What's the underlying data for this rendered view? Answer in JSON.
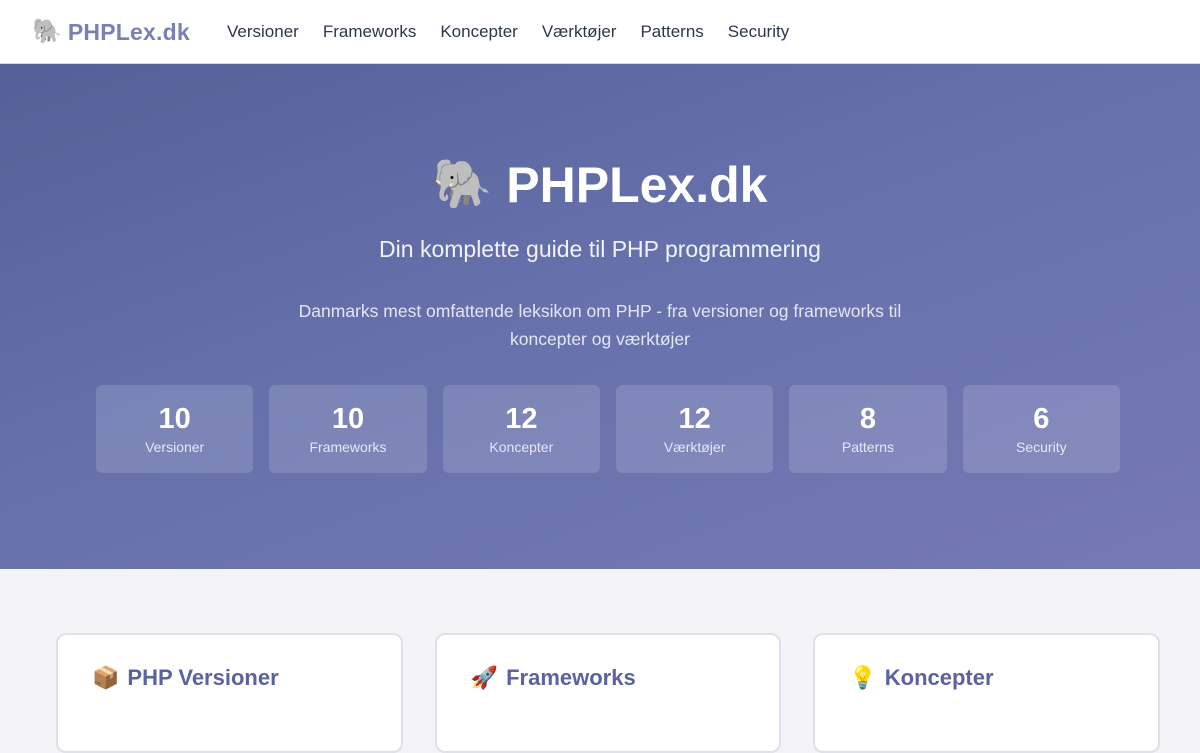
{
  "nav": {
    "brand_emoji": "🐘",
    "brand": "PHPLex.dk",
    "links": [
      "Versioner",
      "Frameworks",
      "Koncepter",
      "Værktøjer",
      "Patterns",
      "Security"
    ]
  },
  "hero": {
    "emoji": "🐘",
    "title": "PHPLex.dk",
    "subtitle": "Din komplette guide til PHP programmering",
    "description": "Danmarks mest omfattende leksikon om PHP - fra versioner og frameworks til koncepter og værktøjer",
    "stats": [
      {
        "value": "10",
        "label": "Versioner"
      },
      {
        "value": "10",
        "label": "Frameworks"
      },
      {
        "value": "12",
        "label": "Koncepter"
      },
      {
        "value": "12",
        "label": "Værktøjer"
      },
      {
        "value": "8",
        "label": "Patterns"
      },
      {
        "value": "6",
        "label": "Security"
      }
    ]
  },
  "cards": [
    {
      "emoji": "📦",
      "title": "PHP Versioner"
    },
    {
      "emoji": "🚀",
      "title": "Frameworks"
    },
    {
      "emoji": "💡",
      "title": "Koncepter"
    }
  ],
  "colors": {
    "brand": "#7a7fb6",
    "hero_start": "#555f98",
    "hero_end": "#7579b5",
    "page_bg": "#f3f3f8"
  }
}
